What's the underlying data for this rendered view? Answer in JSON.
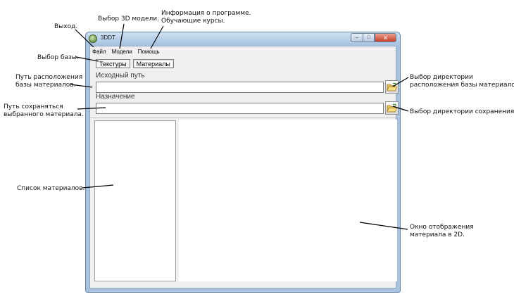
{
  "callouts": {
    "exit": "Выход.",
    "model_select": "Выбор 3D модели.",
    "about_line1": "Информация о программе.",
    "about_line2": "Обучающие курсы.",
    "base_select": "Выбор базы.",
    "source_path_line1": "Путь расположения",
    "source_path_line2": "базы материалов.",
    "dest_path_line1": "Путь сохраняться",
    "dest_path_line2": "выбранного материала.",
    "browse_source_line1": "Выбор директории",
    "browse_source_line2": "расположения базы материалов.",
    "browse_dest": "Выбор директории сохранения.",
    "materials_list": "Список материалов.",
    "view_window_line1": "Окно отображения",
    "view_window_line2": "материала в 2D."
  },
  "window": {
    "title": "3DDT",
    "controls": {
      "minimize": "–",
      "maximize": "□",
      "close": "x"
    }
  },
  "menu": [
    {
      "label": "Файл"
    },
    {
      "label": "Модели"
    },
    {
      "label": "Помощь"
    }
  ],
  "tabs": [
    {
      "label": "Текстуры"
    },
    {
      "label": "Материалы",
      "active": true
    }
  ],
  "fields": {
    "source_label": "Исходный путь",
    "source_value": "",
    "dest_label": "Назначение",
    "dest_value": ""
  },
  "icons": {
    "browse": "folder-open-icon",
    "app": "app-icon"
  }
}
